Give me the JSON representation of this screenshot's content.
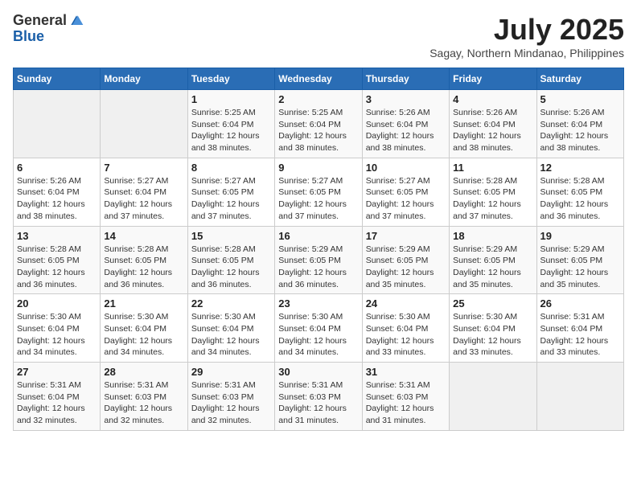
{
  "logo": {
    "general": "General",
    "blue": "Blue"
  },
  "title": {
    "month_year": "July 2025",
    "location": "Sagay, Northern Mindanao, Philippines"
  },
  "weekdays": [
    "Sunday",
    "Monday",
    "Tuesday",
    "Wednesday",
    "Thursday",
    "Friday",
    "Saturday"
  ],
  "weeks": [
    [
      {
        "day": "",
        "info": ""
      },
      {
        "day": "",
        "info": ""
      },
      {
        "day": "1",
        "info": "Sunrise: 5:25 AM\nSunset: 6:04 PM\nDaylight: 12 hours and 38 minutes."
      },
      {
        "day": "2",
        "info": "Sunrise: 5:25 AM\nSunset: 6:04 PM\nDaylight: 12 hours and 38 minutes."
      },
      {
        "day": "3",
        "info": "Sunrise: 5:26 AM\nSunset: 6:04 PM\nDaylight: 12 hours and 38 minutes."
      },
      {
        "day": "4",
        "info": "Sunrise: 5:26 AM\nSunset: 6:04 PM\nDaylight: 12 hours and 38 minutes."
      },
      {
        "day": "5",
        "info": "Sunrise: 5:26 AM\nSunset: 6:04 PM\nDaylight: 12 hours and 38 minutes."
      }
    ],
    [
      {
        "day": "6",
        "info": "Sunrise: 5:26 AM\nSunset: 6:04 PM\nDaylight: 12 hours and 38 minutes."
      },
      {
        "day": "7",
        "info": "Sunrise: 5:27 AM\nSunset: 6:04 PM\nDaylight: 12 hours and 37 minutes."
      },
      {
        "day": "8",
        "info": "Sunrise: 5:27 AM\nSunset: 6:05 PM\nDaylight: 12 hours and 37 minutes."
      },
      {
        "day": "9",
        "info": "Sunrise: 5:27 AM\nSunset: 6:05 PM\nDaylight: 12 hours and 37 minutes."
      },
      {
        "day": "10",
        "info": "Sunrise: 5:27 AM\nSunset: 6:05 PM\nDaylight: 12 hours and 37 minutes."
      },
      {
        "day": "11",
        "info": "Sunrise: 5:28 AM\nSunset: 6:05 PM\nDaylight: 12 hours and 37 minutes."
      },
      {
        "day": "12",
        "info": "Sunrise: 5:28 AM\nSunset: 6:05 PM\nDaylight: 12 hours and 36 minutes."
      }
    ],
    [
      {
        "day": "13",
        "info": "Sunrise: 5:28 AM\nSunset: 6:05 PM\nDaylight: 12 hours and 36 minutes."
      },
      {
        "day": "14",
        "info": "Sunrise: 5:28 AM\nSunset: 6:05 PM\nDaylight: 12 hours and 36 minutes."
      },
      {
        "day": "15",
        "info": "Sunrise: 5:28 AM\nSunset: 6:05 PM\nDaylight: 12 hours and 36 minutes."
      },
      {
        "day": "16",
        "info": "Sunrise: 5:29 AM\nSunset: 6:05 PM\nDaylight: 12 hours and 36 minutes."
      },
      {
        "day": "17",
        "info": "Sunrise: 5:29 AM\nSunset: 6:05 PM\nDaylight: 12 hours and 35 minutes."
      },
      {
        "day": "18",
        "info": "Sunrise: 5:29 AM\nSunset: 6:05 PM\nDaylight: 12 hours and 35 minutes."
      },
      {
        "day": "19",
        "info": "Sunrise: 5:29 AM\nSunset: 6:05 PM\nDaylight: 12 hours and 35 minutes."
      }
    ],
    [
      {
        "day": "20",
        "info": "Sunrise: 5:30 AM\nSunset: 6:04 PM\nDaylight: 12 hours and 34 minutes."
      },
      {
        "day": "21",
        "info": "Sunrise: 5:30 AM\nSunset: 6:04 PM\nDaylight: 12 hours and 34 minutes."
      },
      {
        "day": "22",
        "info": "Sunrise: 5:30 AM\nSunset: 6:04 PM\nDaylight: 12 hours and 34 minutes."
      },
      {
        "day": "23",
        "info": "Sunrise: 5:30 AM\nSunset: 6:04 PM\nDaylight: 12 hours and 34 minutes."
      },
      {
        "day": "24",
        "info": "Sunrise: 5:30 AM\nSunset: 6:04 PM\nDaylight: 12 hours and 33 minutes."
      },
      {
        "day": "25",
        "info": "Sunrise: 5:30 AM\nSunset: 6:04 PM\nDaylight: 12 hours and 33 minutes."
      },
      {
        "day": "26",
        "info": "Sunrise: 5:31 AM\nSunset: 6:04 PM\nDaylight: 12 hours and 33 minutes."
      }
    ],
    [
      {
        "day": "27",
        "info": "Sunrise: 5:31 AM\nSunset: 6:04 PM\nDaylight: 12 hours and 32 minutes."
      },
      {
        "day": "28",
        "info": "Sunrise: 5:31 AM\nSunset: 6:03 PM\nDaylight: 12 hours and 32 minutes."
      },
      {
        "day": "29",
        "info": "Sunrise: 5:31 AM\nSunset: 6:03 PM\nDaylight: 12 hours and 32 minutes."
      },
      {
        "day": "30",
        "info": "Sunrise: 5:31 AM\nSunset: 6:03 PM\nDaylight: 12 hours and 31 minutes."
      },
      {
        "day": "31",
        "info": "Sunrise: 5:31 AM\nSunset: 6:03 PM\nDaylight: 12 hours and 31 minutes."
      },
      {
        "day": "",
        "info": ""
      },
      {
        "day": "",
        "info": ""
      }
    ]
  ]
}
